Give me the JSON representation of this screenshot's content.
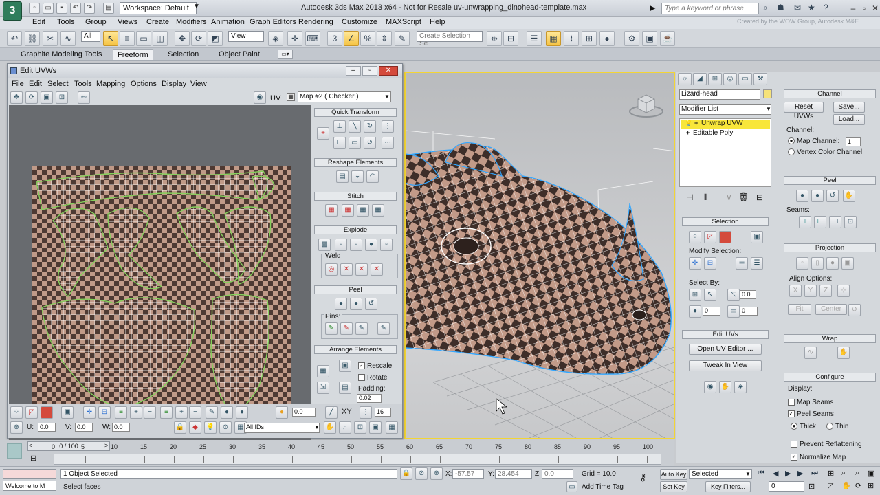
{
  "app": {
    "logo": "3",
    "workspace": "Workspace: Default",
    "title": "Autodesk 3ds Max 2013 x64    -  Not for Resale    uv-unwrapping_dinohead-template.max",
    "search_placeholder": "Type a keyword or phrase",
    "watermark": "Created by the WOW Group, Autodesk M&E"
  },
  "menus": [
    "Edit",
    "Tools",
    "Group",
    "Views",
    "Create",
    "Modifiers",
    "Animation",
    "Graph Editors",
    "Rendering",
    "Customize",
    "MAXScript",
    "Help"
  ],
  "toolbar": {
    "selection_filter": "All",
    "ref_coord": "View",
    "selection_set": "Create Selection Se"
  },
  "ribbon": {
    "tabs": [
      "Graphite Modeling Tools",
      "Freeform",
      "Selection",
      "Object Paint"
    ],
    "active_tab": "Freeform"
  },
  "uvw": {
    "title": "Edit UVWs",
    "menus": [
      "File",
      "Edit",
      "Select",
      "Tools",
      "Mapping",
      "Options",
      "Display",
      "View"
    ],
    "uv_label": "UV",
    "map_dropdown": "Map #2  ( Checker )",
    "quick_transform": "Quick Transform",
    "reshape_elements": "Reshape Elements",
    "stitch": "Stitch",
    "explode": "Explode",
    "weld": "Weld",
    "peel": "Peel",
    "pins": "Pins:",
    "arrange_elements": "Arrange Elements",
    "rescale": "Rescale",
    "rotate": "Rotate",
    "padding_label": "Padding:",
    "padding_value": "0.02",
    "bottom_value1": "0.0",
    "xy_label": "XY",
    "bottom_value2": "16",
    "u_label": "U:",
    "u_value": "0.0",
    "v_label": "V:",
    "v_value": "0.0",
    "w_label": "W:",
    "w_value": "0.0",
    "ids_dropdown": "All IDs"
  },
  "command_panel": {
    "object_name": "Lizard-head",
    "modifier_list": "Modifier List",
    "stack": [
      "Unwrap UVW",
      "Editable Poly"
    ],
    "selection_head": "Selection",
    "modify_selection": "Modify Selection:",
    "select_by": "Select By:",
    "select_by_value1": "0.0",
    "select_by_value2": "0",
    "select_by_value3": "0",
    "edit_uvs_head": "Edit UVs",
    "open_uv_editor": "Open UV Editor ...",
    "tweak_in_view": "Tweak In View",
    "channel_head": "Channel",
    "reset_uvws": "Reset UVWs",
    "save": "Save...",
    "load": "Load...",
    "channel_label": "Channel:",
    "map_channel": "Map Channel:",
    "map_channel_value": "1",
    "vertex_color_channel": "Vertex Color Channel",
    "peel_head": "Peel",
    "seams": "Seams:",
    "projection_head": "Projection",
    "align_options": "Align Options:",
    "align_x": "X",
    "align_y": "Y",
    "align_z": "Z",
    "fit": "Fit",
    "center": "Center",
    "wrap_head": "Wrap",
    "configure_head": "Configure",
    "display_label": "Display:",
    "map_seams": "Map Seams",
    "peel_seams": "Peel Seams",
    "thick": "Thick",
    "thin": "Thin",
    "prevent_reflattening": "Prevent Reflattening",
    "normalize_map": "Normalize Map"
  },
  "timeline": {
    "frame_display": "0 / 100",
    "ticks": [
      "0",
      "5",
      "10",
      "15",
      "20",
      "25",
      "30",
      "35",
      "40",
      "45",
      "50",
      "55",
      "60",
      "65",
      "70",
      "75",
      "80",
      "85",
      "90",
      "95",
      "100"
    ]
  },
  "status": {
    "maxscript": "Welcome to M",
    "objects_selected": "1 Object Selected",
    "prompt": "Select faces",
    "x_label": "X:",
    "x_value": "-57.57",
    "y_label": "Y:",
    "y_value": "28.454",
    "z_label": "Z:",
    "z_value": "0.0",
    "grid": "Grid = 10.0",
    "add_time_tag": "Add Time Tag",
    "auto_key": "Auto Key",
    "set_key": "Set Key",
    "selected": "Selected",
    "key_filters": "Key Filters...",
    "frame": "0"
  },
  "colors": {
    "active_viewport_border": "#f3d535",
    "selected_modifier": "#f8e63a",
    "uv_seam": "#86d05c",
    "edge_selection": "#33a7ff"
  }
}
